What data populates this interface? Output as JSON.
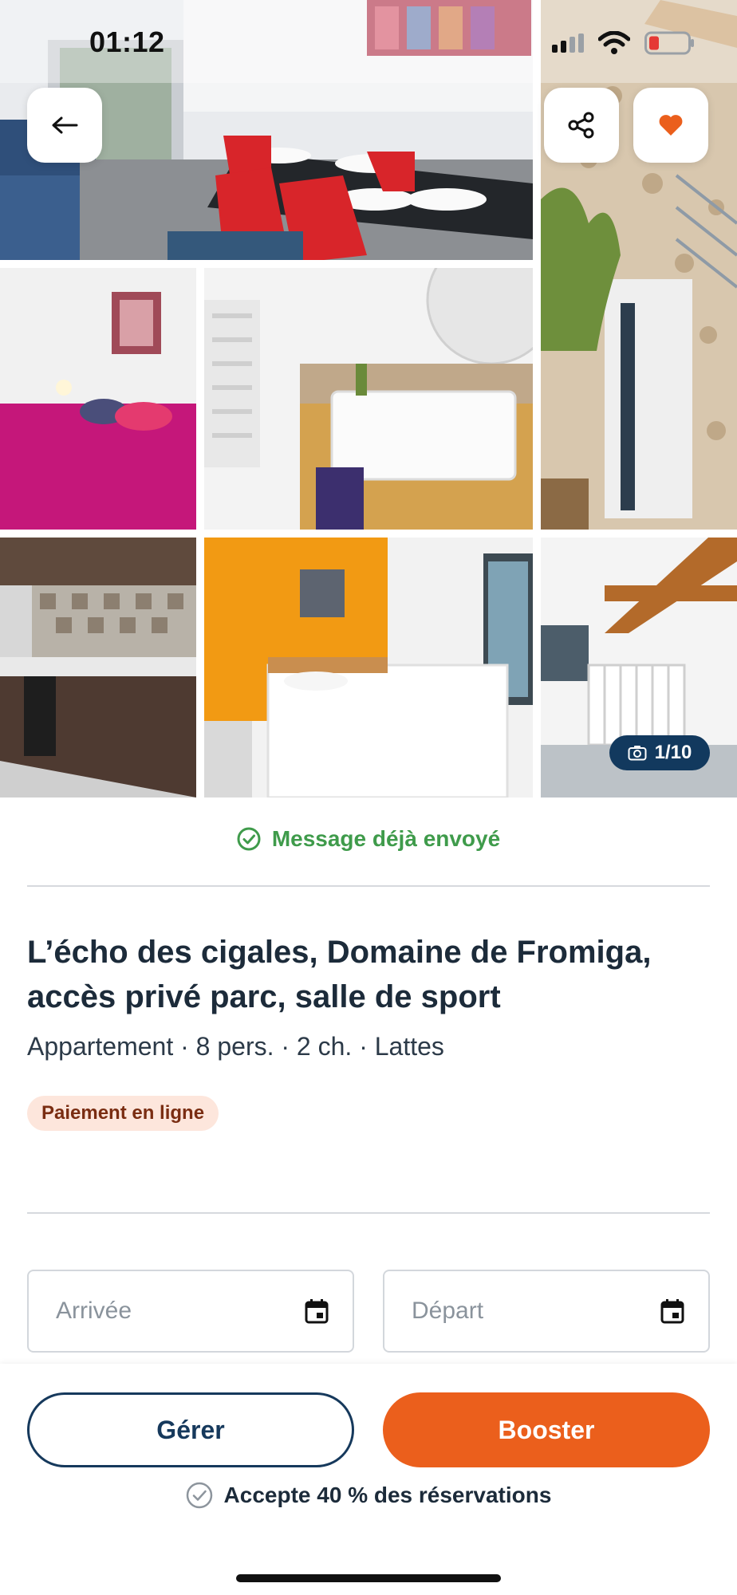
{
  "status_bar": {
    "time": "01:12",
    "icons": [
      "cellular-signal-icon",
      "wifi-icon",
      "battery-low-icon"
    ]
  },
  "gallery": {
    "photos": [
      "dining-room",
      "stone-exterior",
      "pink-bedroom",
      "bathroom-sink",
      "kitchen",
      "orange-bedroom",
      "attic-crib-room"
    ],
    "counter": "1/10",
    "counter_icon": "camera-icon"
  },
  "header_actions": {
    "back_icon": "arrow-left-icon",
    "share_icon": "share-icon",
    "favorite_icon": "heart-icon",
    "favorite_color": "#eb5f1c"
  },
  "message_status": {
    "text": "Message déjà envoyé",
    "icon": "check-circle-icon",
    "color": "#3f9b4b"
  },
  "listing": {
    "title": "L’écho des cigales, Domaine de Fromiga, accès privé parc, salle de sport",
    "subtitle": "Appartement · 8 pers. · 2 ch. · Lattes",
    "badge": "Paiement en ligne"
  },
  "dates": {
    "arrival_placeholder": "Arrivée",
    "departure_placeholder": "Départ",
    "icon": "calendar-icon"
  },
  "actions": {
    "manage_label": "Gérer",
    "boost_label": "Booster",
    "accent_color": "#eb5f1c",
    "brand_color": "#16395c"
  },
  "acceptance": {
    "text": "Accepte 40 % des réservations",
    "icon": "check-circle-outline-icon"
  }
}
